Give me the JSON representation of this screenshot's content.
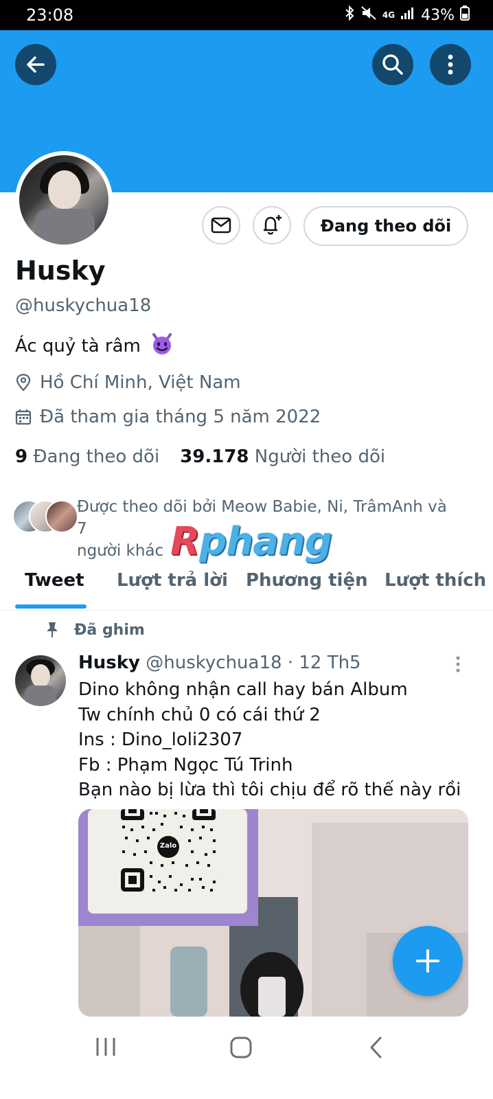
{
  "status_bar": {
    "time": "23:08",
    "battery": "43%",
    "network": "4G"
  },
  "profile": {
    "name": "Husky",
    "handle": "@huskychua18",
    "bio": "Ác quỷ tà râm",
    "bio_emoji": "smiling-devil",
    "location": "Hồ Chí Minh, Việt Nam",
    "joined": "Đã tham gia tháng 5 năm 2022",
    "follow_button": "Đang theo dõi",
    "following_count": "9",
    "following_label": "Đang theo dõi",
    "followers_count": "39.178",
    "followers_label": "Người theo dõi",
    "followed_by_line1": "Được theo dõi bởi Meow Babie, Ni, TrâmAnh và 7",
    "followed_by_line2": "người khác"
  },
  "watermark": {
    "first": "R",
    "rest": "phang"
  },
  "tabs": [
    {
      "label": "Tweet",
      "active": true
    },
    {
      "label": "Lượt trả lời",
      "active": false
    },
    {
      "label": "Phương tiện",
      "active": false
    },
    {
      "label": "Lượt thích",
      "active": false
    }
  ],
  "pinned_tweet": {
    "pinned_label": "Đã ghim",
    "author": "Husky",
    "handle": "@huskychua18",
    "date": "· 12 Th5",
    "lines": [
      "Dino không nhận call hay bán Album",
      "Tw chính chủ 0 có cái thứ 2",
      "Ins : Dino_loli2307",
      "Fb : Phạm Ngọc Tú Trinh",
      "Bạn nào bị lừa thì tôi chịu để rõ thế này rồi"
    ],
    "qr_label": "Zalo"
  },
  "colors": {
    "accent": "#1d9bf0",
    "banner": "#1d9bf0",
    "secondary_text": "#536471"
  }
}
